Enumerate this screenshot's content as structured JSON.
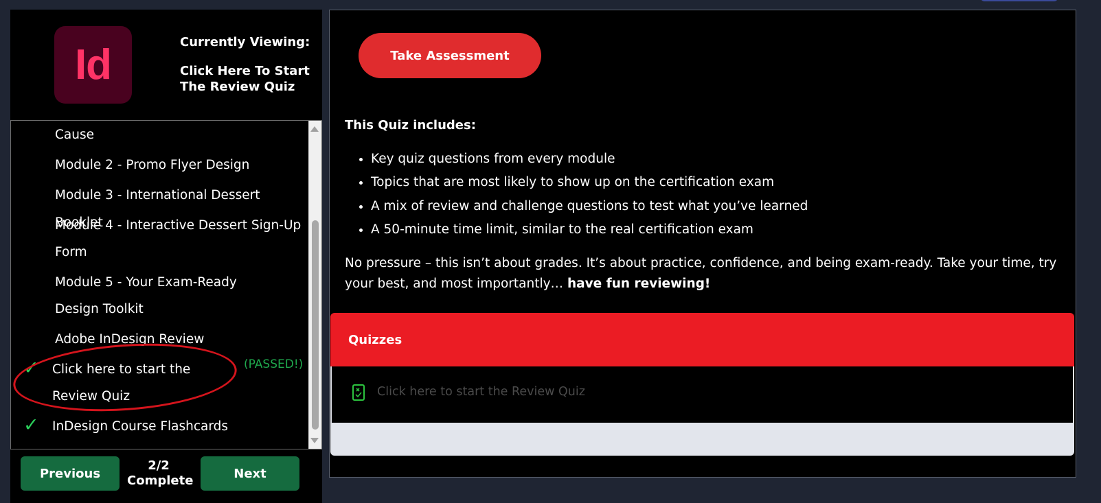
{
  "sidebar": {
    "logo_text": "Id",
    "currently_viewing_label": "Currently Viewing:",
    "current_item": "Click Here To Start The Review Quiz",
    "items": [
      {
        "label": "Cause"
      },
      {
        "label": "Module 2 - Promo Flyer Design"
      },
      {
        "label": "Module 3 - International Dessert Booklet"
      },
      {
        "label": "Module 4 - Interactive Dessert Sign-Up Form"
      },
      {
        "label": "Module 5 - Your Exam-Ready Design Toolkit"
      },
      {
        "label": "Adobe InDesign Review"
      },
      {
        "label": "Click here to start the Review Quiz",
        "completed": true,
        "status": "(PASSED!)"
      },
      {
        "label": "InDesign Course Flashcards",
        "completed": true
      }
    ],
    "check_icon": "✓",
    "previous_label": "Previous",
    "next_label": "Next",
    "progress_count": "2/2",
    "progress_label": "Complete"
  },
  "main": {
    "assessment_button": "Take Assessment",
    "includes_title": "This Quiz includes:",
    "bullets": [
      "Key quiz questions from every module",
      "Topics that are most likely to show up on the certification exam",
      "A mix of review and challenge questions to test what you’ve learned",
      "A 50-minute time limit, similar to the real certification exam"
    ],
    "paragraph": "No pressure – this isn’t about grades. It’s about practice, confidence, and being exam-ready. Take your time, try your best, and most importantly…",
    "paragraph_bold": "have fun reviewing!",
    "quizzes_title": "Quizzes",
    "quiz_link": "Click here to start the Review Quiz"
  },
  "colors": {
    "accent_red": "#eb1c24",
    "button_red": "#e02c2e",
    "nav_green": "#156b3f",
    "check_green": "#2bd05b",
    "logo_bg": "#49021f",
    "logo_fg": "#ff3366"
  }
}
